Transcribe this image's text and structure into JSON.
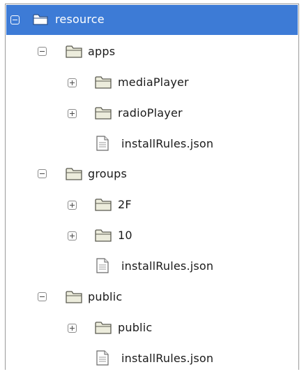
{
  "tree": {
    "root": {
      "label": "resource",
      "expanded": true,
      "selected": true,
      "icon": "folder-icon"
    },
    "apps": {
      "label": "apps",
      "expanded": true,
      "icon": "folder-icon",
      "children": [
        {
          "label": "mediaPlayer",
          "type": "folder",
          "expanded": false
        },
        {
          "label": "radioPlayer",
          "type": "folder",
          "expanded": false
        },
        {
          "label": "installRules.json",
          "type": "file"
        }
      ]
    },
    "groups": {
      "label": "groups",
      "expanded": true,
      "icon": "folder-icon",
      "children": [
        {
          "label": "2F",
          "type": "folder",
          "expanded": false
        },
        {
          "label": "10",
          "type": "folder",
          "expanded": false
        },
        {
          "label": "installRules.json",
          "type": "file"
        }
      ]
    },
    "public": {
      "label": "public",
      "expanded": true,
      "icon": "folder-icon",
      "children": [
        {
          "label": "public",
          "type": "folder",
          "expanded": false
        },
        {
          "label": "installRules.json",
          "type": "file"
        }
      ]
    }
  },
  "colors": {
    "selection": "#3d7bd6",
    "folder_fill": "#ececdc",
    "folder_stroke": "#5a5a50",
    "text": "#1a1a1a"
  }
}
